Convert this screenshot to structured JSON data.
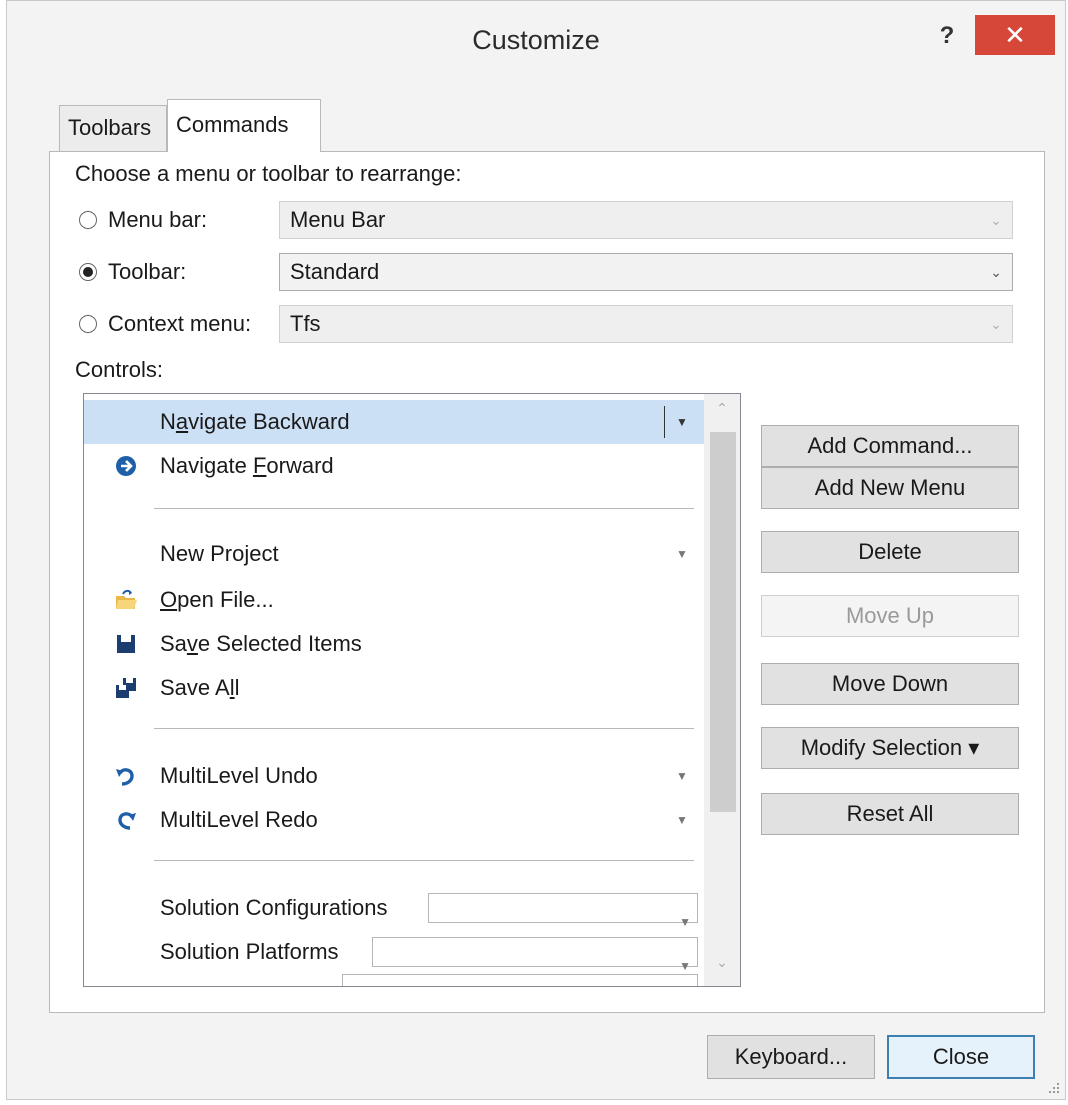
{
  "window": {
    "title": "Customize",
    "help_label": "?",
    "close_glyph": "✕"
  },
  "tabs": [
    {
      "label": "Toolbars",
      "selected": false
    },
    {
      "label": "Commands",
      "selected": true
    }
  ],
  "commands": {
    "choose_label": "Choose a menu or toolbar to rearrange:",
    "options": [
      {
        "label": "Menu bar:",
        "value": "Menu Bar",
        "checked": false,
        "enabled": false
      },
      {
        "label": "Toolbar:",
        "value": "Standard",
        "checked": true,
        "enabled": true
      },
      {
        "label": "Context menu:",
        "value": "Tfs",
        "checked": false,
        "enabled": false
      }
    ],
    "controls_label": "Controls:"
  },
  "controls": [
    {
      "pre": "N",
      "u": "a",
      "post": "vigate Backward",
      "icon": "",
      "selected": true,
      "dropdown": true
    },
    {
      "pre": "Navigate ",
      "u": "F",
      "post": "orward",
      "icon": "navigate-forward-icon",
      "dropdown": false
    },
    {
      "pre": "New Project",
      "u": "",
      "post": "",
      "icon": "",
      "dropdown": true
    },
    {
      "pre": "",
      "u": "O",
      "post": "pen File...",
      "icon": "open-file-icon",
      "dropdown": false
    },
    {
      "pre": "Sa",
      "u": "v",
      "post": "e Selected Items",
      "icon": "save-icon",
      "dropdown": false
    },
    {
      "pre": "Save A",
      "u": "l",
      "post": "l",
      "icon": "save-all-icon",
      "dropdown": false
    },
    {
      "pre": "MultiLevel Undo",
      "u": "",
      "post": "",
      "icon": "undo-icon",
      "dropdown": true
    },
    {
      "pre": "MultiLevel Redo",
      "u": "",
      "post": "",
      "icon": "redo-icon",
      "dropdown": true
    },
    {
      "pre": "Solution Configurations",
      "u": "",
      "post": "",
      "icon": "",
      "dropdown": false
    },
    {
      "pre": "Solution Platforms",
      "u": "",
      "post": "",
      "icon": "",
      "dropdown": false
    }
  ],
  "buttons": [
    {
      "label": "Add Command...",
      "enabled": true
    },
    {
      "label": "Add New Menu",
      "enabled": true
    },
    {
      "label": "Delete",
      "enabled": true
    },
    {
      "label": "Move Up",
      "enabled": false
    },
    {
      "label": "Move Down",
      "enabled": true
    },
    {
      "label": "Modify Selection ▾",
      "enabled": true
    },
    {
      "label": "Reset All",
      "enabled": true
    }
  ],
  "footer": {
    "keyboard_label": "Keyboard...",
    "close_label": "Close"
  }
}
